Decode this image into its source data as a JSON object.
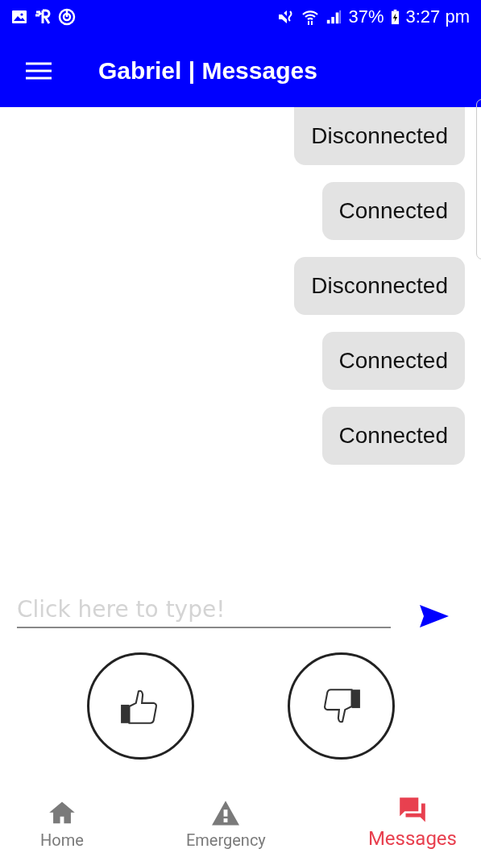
{
  "status_bar": {
    "battery": "37%",
    "time": "3:27 pm"
  },
  "app_bar": {
    "title": "Gabriel | Messages"
  },
  "messages": [
    {
      "text": "Disconnected"
    },
    {
      "text": "Connected"
    },
    {
      "text": "Disconnected"
    },
    {
      "text": "Connected"
    },
    {
      "text": "Connected"
    }
  ],
  "composer": {
    "placeholder": "Click here to type!"
  },
  "reactions": [
    {
      "kind": "like"
    },
    {
      "kind": "dislike"
    }
  ],
  "tabs": [
    {
      "label": "Home",
      "kind": "home",
      "selected": false
    },
    {
      "label": "Emergency",
      "kind": "emergency",
      "selected": false
    },
    {
      "label": "Messages",
      "kind": "messages",
      "selected": true
    }
  ]
}
